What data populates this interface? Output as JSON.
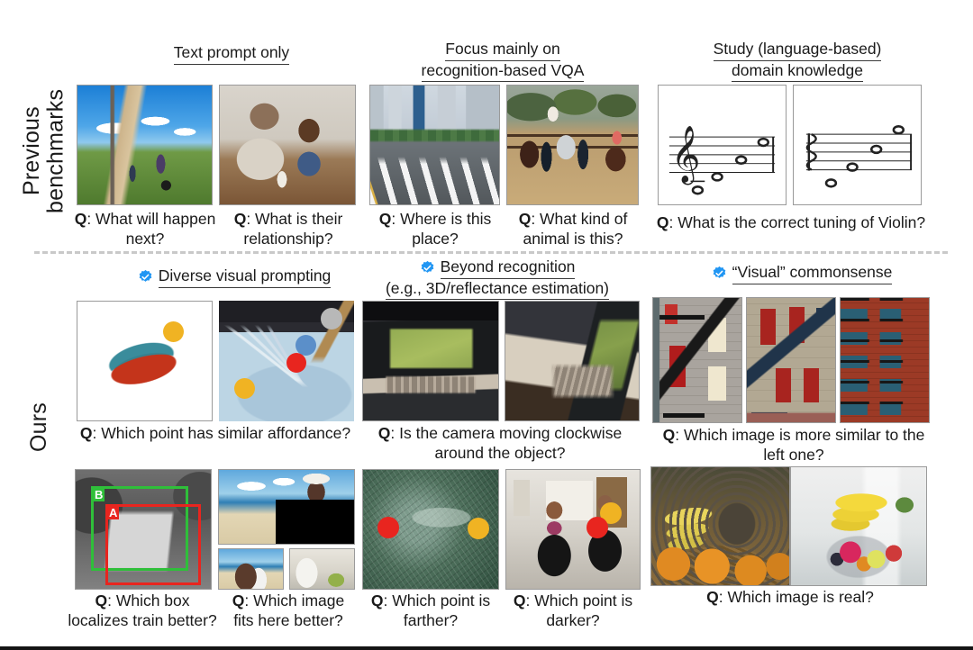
{
  "figure": {
    "row_labels": {
      "previous": "Previous\nbenchmarks",
      "ours": "Ours"
    },
    "divider": "dashed-separator"
  },
  "previous_benchmarks": {
    "columns": [
      {
        "id": "text-prompt-only",
        "heading_lines": [
          "Text prompt only"
        ],
        "panels": [
          {
            "id": "dirt-road-bikers",
            "scene": "children on a grassy hillside dirt road with a motorbike",
            "caption_prefix": "Q",
            "caption": ": What will happen next?"
          },
          {
            "id": "grandfather-girl-table",
            "scene": "older man and young girl smiling at a table with a mug and tablet",
            "caption_prefix": "Q",
            "caption": ": What is their relationship?"
          }
        ]
      },
      {
        "id": "recognition-vqa",
        "heading_lines": [
          "Focus mainly on",
          "recognition-based VQA"
        ],
        "panels": [
          {
            "id": "city-crosswalk",
            "scene": "empty city street with crosswalk and high-rise towers",
            "caption_prefix": "Q",
            "caption": ": Where is this place?"
          },
          {
            "id": "horse-riders",
            "scene": "children riding horses in a sandy paddock",
            "caption_prefix": "Q",
            "caption": ": What kind of animal is this?"
          }
        ]
      },
      {
        "id": "domain-knowledge",
        "heading_lines": [
          "Study (language-based)",
          "domain knowledge"
        ],
        "panels": [
          {
            "id": "treble-staff",
            "scene": "music staff with treble clef and four whole notes"
          },
          {
            "id": "alto-staff",
            "scene": "music staff with alto clef and four whole notes"
          }
        ],
        "caption_prefix": "Q",
        "caption": ": What is the correct tuning of Violin?"
      }
    ]
  },
  "ours": {
    "columns": [
      {
        "id": "diverse-visual-prompting",
        "badge": "blue-verified-check",
        "heading_lines": [
          "Diverse visual prompting"
        ],
        "rows": [
          {
            "panels": [
              {
                "id": "toothbrush-3d",
                "scene": "3D reconstruction of a brush-like object with a yellow point marker",
                "markers": [
                  {
                    "color": "#f0b323",
                    "label": "yellow-dot"
                  }
                ]
              },
              {
                "id": "whisk-bowl",
                "scene": "whisk in a bowl of blue batter with grey, blue, red and yellow point markers",
                "markers": [
                  {
                    "color": "#b8b8b8",
                    "label": "grey-dot"
                  },
                  {
                    "color": "#5b8fc9",
                    "label": "blue-dot"
                  },
                  {
                    "color": "#e8251f",
                    "label": "red-dot"
                  },
                  {
                    "color": "#f0b323",
                    "label": "yellow-dot"
                  }
                ]
              }
            ],
            "caption_prefix": "Q",
            "caption": ": Which point has similar affordance?"
          },
          {
            "panels": [
              {
                "id": "train-boxes",
                "scene": "black and white photo of a train with red box A and green box B",
                "boxes": [
                  {
                    "label": "B",
                    "color": "#2fbf3a"
                  },
                  {
                    "label": "A",
                    "color": "#e8251f"
                  }
                ]
              },
              {
                "id": "beach-inpaint",
                "scene": "beach photo with a black masked rectangle and two candidate crops below"
              }
            ],
            "caption_prefix": "Q",
            "caption_line1": ": Which box",
            "caption_line2": "localizes train better?",
            "caption2_prefix": "Q",
            "caption2_line1": ": Which image",
            "caption2_line2": "fits here better?"
          }
        ]
      },
      {
        "id": "beyond-recognition",
        "badge": "blue-verified-check",
        "heading_lines": [
          "Beyond recognition",
          "(e.g., 3D/reflectance estimation)"
        ],
        "rows": [
          {
            "panels": [
              {
                "id": "laptop-view-1",
                "scene": "laptop on a desk seen from the front"
              },
              {
                "id": "laptop-view-2",
                "scene": "same laptop seen from a rotated viewpoint"
              }
            ],
            "caption_prefix": "Q",
            "caption": ": Is the camera moving clockwise around the object?"
          },
          {
            "panels": [
              {
                "id": "pine-branch",
                "scene": "close-up of a pine branch with red and yellow point markers",
                "markers": [
                  {
                    "color": "#e8251f",
                    "label": "red-dot"
                  },
                  {
                    "color": "#f0b323",
                    "label": "yellow-dot"
                  }
                ]
              },
              {
                "id": "kitchen-two-people",
                "scene": "two people in a kitchen with yellow and red point markers",
                "markers": [
                  {
                    "color": "#f0b323",
                    "label": "yellow-dot"
                  },
                  {
                    "color": "#e8251f",
                    "label": "red-dot"
                  }
                ]
              }
            ],
            "caption_prefix": "Q",
            "caption_line1": ": Which point is",
            "caption_line2": "farther?",
            "caption2_prefix": "Q",
            "caption2_line1": ": Which point is",
            "caption2_line2": "darker?"
          }
        ]
      },
      {
        "id": "visual-commonsense",
        "badge": "blue-verified-check",
        "heading_lines": [
          "“Visual” commonsense"
        ],
        "rows": [
          {
            "panels": [
              {
                "id": "facade-grey-fire-escape",
                "scene": "grey stone facade with black fire escape and red door"
              },
              {
                "id": "facade-stucco-fire-escape",
                "scene": "stucco facade with blue fire escape and red windows"
              },
              {
                "id": "facade-brick-balconies",
                "scene": "red brick facade with rows of balconies"
              }
            ],
            "caption_prefix": "Q",
            "caption": ": Which image is more similar to the left one?"
          },
          {
            "panels": [
              {
                "id": "fruit-basket-real",
                "scene": "basket of bananas, grapes and oranges"
              },
              {
                "id": "fruit-bowl-generated",
                "scene": "wire bowl of bananas and assorted fruit on a counter"
              }
            ],
            "caption_prefix": "Q",
            "caption": ": Which image is real?"
          }
        ]
      }
    ]
  },
  "colors": {
    "badge_blue": "#2196f3",
    "dot_red": "#e8251f",
    "dot_yellow": "#f0b323",
    "dot_blue": "#5b8fc9",
    "dot_grey": "#b8b8b8",
    "box_green": "#2fbf3a",
    "box_red": "#e8251f",
    "divider_grey": "#c9c9c9",
    "text": "#1a1a1a"
  }
}
